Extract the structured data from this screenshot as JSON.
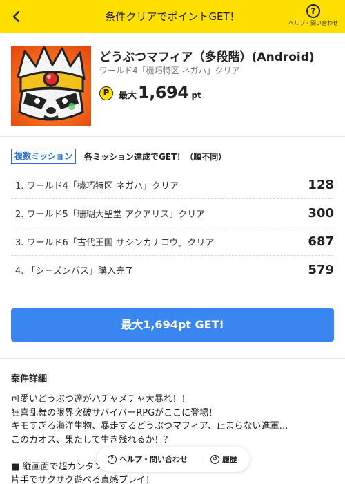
{
  "header": {
    "title": "条件クリアでポイントGET！",
    "help_label": "ヘルプ・問い合わせ",
    "help_icon_glyph": "?",
    "background": "#ffdf00"
  },
  "offer": {
    "title": "どうぶつマフィア（多段階）(Android)",
    "subtitle": "ワールド4「機巧特区 ネガハ」クリア",
    "coin_glyph": "P",
    "points_prefix": "最大",
    "points_value": "1,694",
    "points_unit": "pt"
  },
  "missions": {
    "badge": "複数ミッション",
    "description": "各ミッション達成でGET！（順不同）",
    "items": [
      {
        "label": "1. ワールド4「機巧特区 ネガハ」クリア",
        "points": "128"
      },
      {
        "label": "2. ワールド5「珊瑚大聖堂 アクアリス」クリア",
        "points": "300"
      },
      {
        "label": "3. ワールド6「古代王国 サシンカナコウ」クリア",
        "points": "687"
      },
      {
        "label": "4. 「シーズンパス」購入完了",
        "points": "579"
      }
    ]
  },
  "cta": {
    "label": "最大1,694pt GET!",
    "color": "#3a86f0"
  },
  "details": {
    "title": "案件詳細",
    "lines": [
      "可愛いどうぶつ達がハチャメチャ大暴れ！！",
      "狂喜乱舞の限界突破サバイバーRPGがここに登場！",
      "キモすぎる海洋生物、暴走するどうぶつマフィア、止まらない進軍…",
      "このカオス、果たして生き残れるか！？",
      "",
      "■ 縦画面で超カンタン操作！",
      "片手でサクサク遊べる直感プレイ！"
    ]
  },
  "float_bar": {
    "help_label": "ヘルプ・問い合わせ",
    "help_icon_glyph": "?",
    "history_label": "履歴",
    "history_icon_glyph": "↺"
  }
}
